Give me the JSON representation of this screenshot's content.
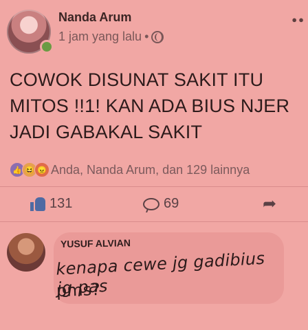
{
  "post": {
    "author": "Nanda Arum",
    "time": "1 jam yang lalu",
    "bullet": "•",
    "text": "COWOK DISUNAT SAKIT ITU MITOS !!1! KAN ADA BIUS NJER JADI GABAKAL SAKIT",
    "reactions_summary": "Anda, Nanda Arum, dan 129 lainnya",
    "reaction_icons": [
      "like-reaction-icon",
      "haha-reaction-icon",
      "angry-reaction-icon"
    ],
    "like_count": "131",
    "comment_count": "69"
  },
  "comment": {
    "author": "YUSUF ALVIAN",
    "line1": "kenapa cewe jg gadibius jg pas",
    "line2": "pms?"
  },
  "colors": {
    "background": "#f1a7a4",
    "like_blue": "#4e6aa3",
    "online_green": "#6a9b43"
  }
}
